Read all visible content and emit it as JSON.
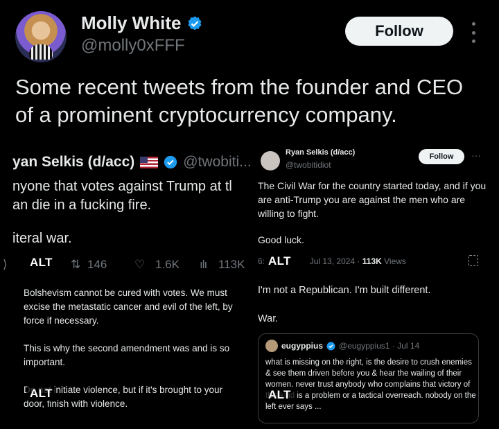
{
  "tweet": {
    "author_name": "Molly White",
    "author_handle": "@molly0xFFF",
    "follow_label": "Follow",
    "text": "Some recent tweets from the founder and CEO of a prominent cryptocurrency company."
  },
  "images": {
    "alt_label": "ALT",
    "img1": {
      "name": "yan Selkis (d/acc)",
      "handle": "@twobiti...",
      "body_line1": "nyone that votes against Trump at tl",
      "body_line2": "an die in a fucking fire.",
      "body_line3": "iteral war.",
      "retweets": "146",
      "likes": "1.6K",
      "views": "113K"
    },
    "img2": {
      "name": "Ryan Selkis (d/acc)",
      "handle": "@twobitidiot",
      "follow_label": "Follow",
      "body": "The Civil War for the country started today, and if you are anti-Trump you are against the men who are willing to fight.",
      "closing": "Good luck.",
      "meta_time": "6:",
      "meta_date": "Jul 13, 2024",
      "meta_views": "113K",
      "meta_views_label": "Views"
    },
    "img3": {
      "p1": "Bolshevism cannot be cured with votes. We must excise the metastatic cancer and evil of the left, by force if necessary.",
      "p2": "This is why the second amendment was and is so important.",
      "p3": "Do not initiate violence, but if it's brought to your door, finish with violence."
    },
    "img4": {
      "line1": "I'm not a Republican. I'm built different.",
      "line2": "War.",
      "quote_name": "eugyppius",
      "quote_meta": "@eugyppius1 · Jul 14",
      "quote_body": "what is missing on the right, is the desire to crush enemies & see them driven before you & hear the wailing of their women. never trust anybody who complains that victory of this kind is a problem or a tactical overreach. nobody on the left ever says ..."
    }
  },
  "colors": {
    "background": "#000000",
    "text": "#e7e9ea",
    "muted": "#71767b",
    "verified": "#1d9bf0",
    "follow_bg": "#eff3f4"
  }
}
